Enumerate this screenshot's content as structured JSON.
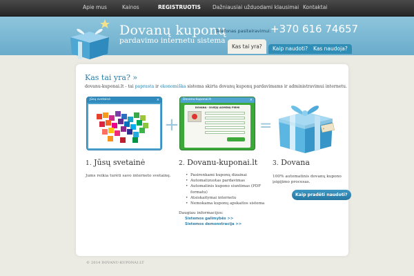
{
  "nav": {
    "items": [
      {
        "label": "Apie mus"
      },
      {
        "label": "Kainos"
      },
      {
        "label": "REGISTRUOTIS"
      },
      {
        "label": "Dažniausiai užduodami klausimai"
      },
      {
        "label": "Kontaktai"
      }
    ]
  },
  "header": {
    "brand_title": "Dovanų  kuponų",
    "brand_subtitle": "pardavimo internetu sistema",
    "phone_label": "Telefonas pasiteiravimui:",
    "phone_number": "+370 616 74657",
    "tabs": [
      {
        "label": "Kas tai yra?",
        "active": true
      },
      {
        "label": "Kaip naudoti?",
        "active": false
      },
      {
        "label": "Kas naudoja?",
        "active": false
      }
    ]
  },
  "main": {
    "heading": "Kas tai yra? »",
    "intro_start": "dovanu-kuponai.lt - tai ",
    "intro_link1": "paprasta",
    "intro_mid": " ir ",
    "intro_link2": "ekonomiška",
    "intro_end": " sistema skirta dovanų kuponų pardavimams ir administravimui internetu.",
    "window1_title": "Jūsų svetainė",
    "window2_title": "Dovanu-kuponai.lt",
    "window2_inner_title": "DOVANA - DVIEJŲ ASMENŲ PIRMI",
    "steps": [
      {
        "num": "1.",
        "title": "Jūsų svetainė",
        "text": "Jums reikia turėti savo interneto svetainę."
      },
      {
        "num": "2.",
        "title": "Dovanu-kuponai.lt"
      },
      {
        "num": "3.",
        "title": "Dovana",
        "text_line1": "100% automatinis dovanų kupono",
        "text_line2": "įsigijimo procesas."
      }
    ],
    "features": [
      "Pasirenkami kuponų dizainai",
      "Automatizuotas pardavimas",
      "Automatinis kupono siuntimas (PDF",
      "formatu)",
      "Atsiskaitymai internetu",
      "Nemokama kuponų apskaitos sistema"
    ],
    "more_title": "Daugiau informacijos:",
    "more_links": [
      {
        "label": "Sistemos galimybės >>"
      },
      {
        "label": "Sistemos demonstracija >>"
      }
    ],
    "cta_label": "Kaip pradėti naudoti?"
  },
  "footer": {
    "copyright": "© 2014 DOVANU-KUPONAI.LT"
  },
  "colors": {
    "accent": "#2b7fa8",
    "header_bg": "#7bb8d4",
    "nav_bg": "#333333",
    "window2_green": "#3da83a",
    "window1_blue": "#4fa3cf"
  }
}
